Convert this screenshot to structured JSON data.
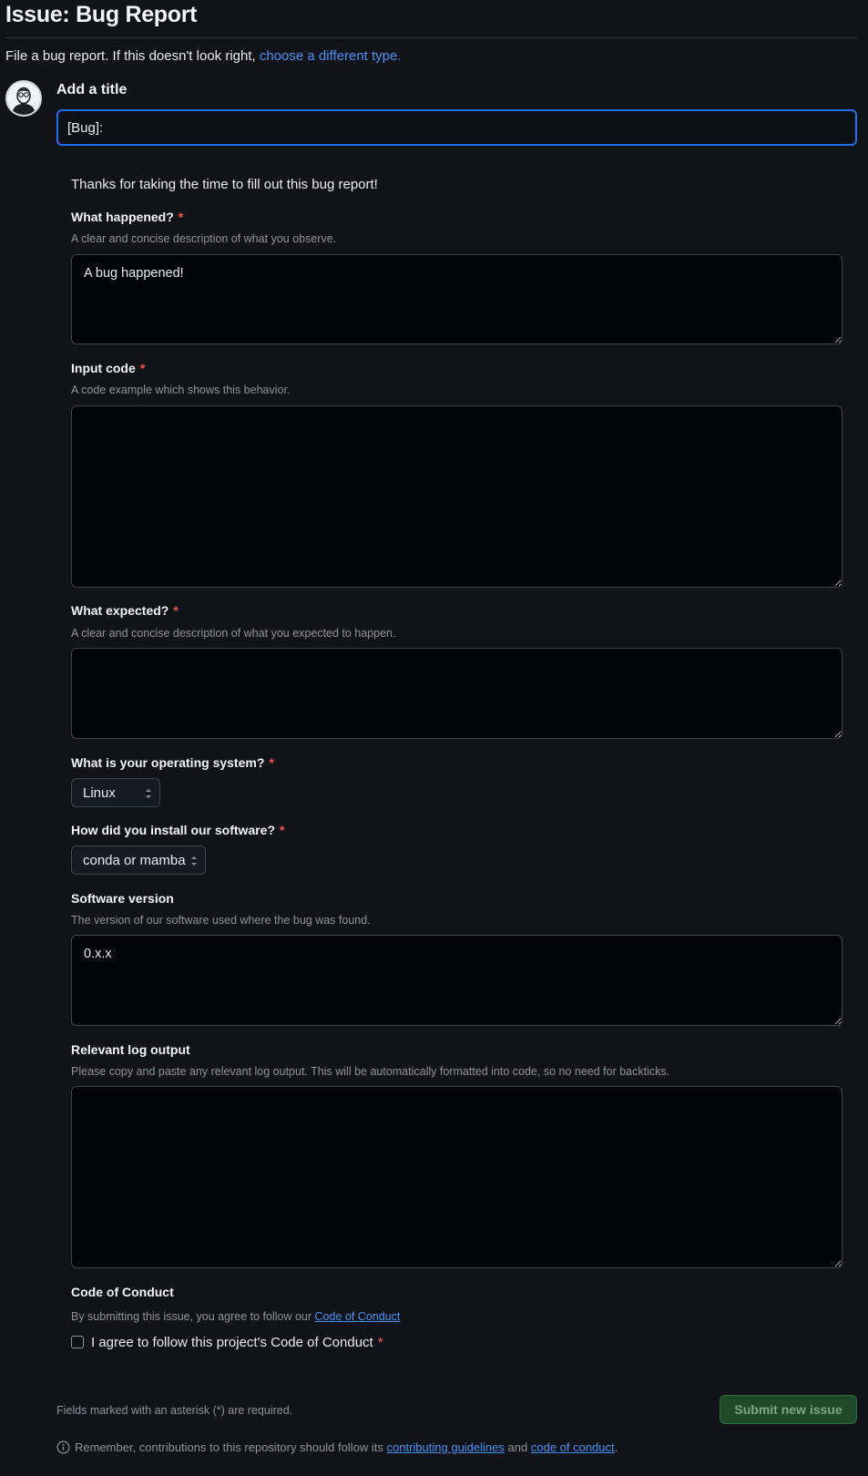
{
  "page": {
    "title": "Issue: Bug Report",
    "intro_text": "File a bug report. If this doesn't look right,",
    "intro_link": "choose a different type."
  },
  "title_field": {
    "label": "Add a title",
    "value": "[Bug]: "
  },
  "thanks_text": "Thanks for taking the time to fill out this bug report!",
  "fields": {
    "what_happened": {
      "label": "What happened?",
      "required": "*",
      "description": "A clear and concise description of what you observe.",
      "value": "A bug happened!"
    },
    "input_code": {
      "label": "Input code",
      "required": "*",
      "description": "A code example which shows this behavior.",
      "value": ""
    },
    "what_expected": {
      "label": "What expected?",
      "required": "*",
      "description": "A clear and concise description of what you expected to happen.",
      "value": ""
    },
    "operating_system": {
      "label": "What is your operating system?",
      "required": "*",
      "selected": "Linux"
    },
    "install_method": {
      "label": "How did you install our software?",
      "required": "*",
      "selected": "conda or mamba"
    },
    "software_version": {
      "label": "Software version",
      "description": "The version of our software used where the bug was found.",
      "value": "0.x.x"
    },
    "log_output": {
      "label": "Relevant log output",
      "description": "Please copy and paste any relevant log output. This will be automatically formatted into code, so no need for backticks.",
      "value": ""
    },
    "code_of_conduct": {
      "label": "Code of Conduct",
      "description": "By submitting this issue, you agree to follow our",
      "description_link": "Code of Conduct",
      "checkbox_label": "I agree to follow this project's Code of Conduct",
      "required": "*",
      "checked": false
    }
  },
  "footer": {
    "required_note": "Fields marked with an asterisk (*) are required.",
    "submit_label": "Submit new issue",
    "remember_text": "Remember, contributions to this repository should follow its",
    "contributing_link": "contributing guidelines",
    "and_text": "and",
    "conduct_link": "code of conduct",
    "period": "."
  },
  "icons": {
    "avatar": "avatar-icon",
    "select_arrows": "select-arrows-icon",
    "info": "info-icon"
  },
  "colors": {
    "background": "#111318",
    "link": "#4493f8",
    "required": "#f85149",
    "focus_border": "#1f6feb",
    "submit_bg": "#1f4a2a"
  }
}
